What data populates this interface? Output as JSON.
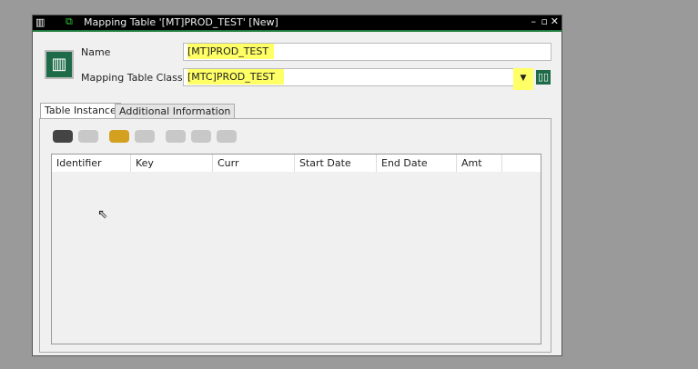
{
  "window": {
    "title": "Mapping Table '[MT]PROD_TEST' [New]"
  },
  "form": {
    "name_label": "Name",
    "name_value": "[MT]PROD_TEST",
    "class_label": "Mapping Table Class",
    "class_value": "[MTC]PROD_TEST"
  },
  "tabs": [
    {
      "label": "Table Instance",
      "active": true
    },
    {
      "label": "Additional Information",
      "active": false
    }
  ],
  "grid": {
    "columns": [
      "Identifier",
      "Key",
      "Curr",
      "Start Date",
      "End Date",
      "Amt"
    ],
    "highlighted": [
      "Key",
      "Curr",
      "Amt"
    ],
    "rows": []
  },
  "colors": {
    "highlight": "#ffff66",
    "title_bar": "#000000",
    "accent": "#1e7a3c"
  }
}
